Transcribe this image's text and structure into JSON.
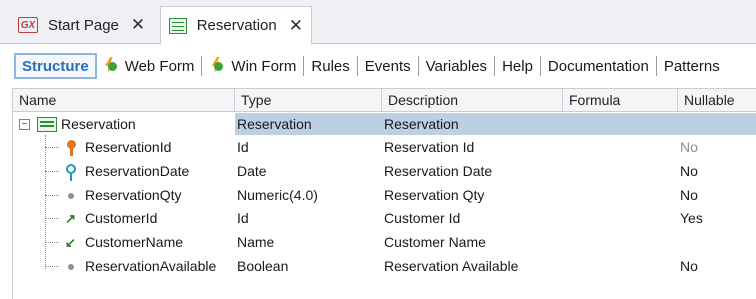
{
  "tabs": [
    {
      "label": "Start Page",
      "icon": "genexus-icon",
      "close": "✕"
    },
    {
      "label": "Reservation",
      "icon": "transaction-icon",
      "close": "✕"
    }
  ],
  "sections": [
    "Structure",
    "Web Form",
    "Win Form",
    "Rules",
    "Events",
    "Variables",
    "Help",
    "Documentation",
    "Patterns"
  ],
  "columns": [
    "Name",
    "Type",
    "Description",
    "Formula",
    "Nullable"
  ],
  "root": {
    "name": "Reservation",
    "type": "Reservation",
    "description": "Reservation",
    "expander": "−"
  },
  "attributes": [
    {
      "name": "ReservationId",
      "type": "Id",
      "description": "Reservation Id",
      "nullable": "No",
      "icon": "primary-key-icon"
    },
    {
      "name": "ReservationDate",
      "type": "Date",
      "description": "Reservation Date",
      "nullable": "No",
      "icon": "index-icon"
    },
    {
      "name": "ReservationQty",
      "type": "Numeric(4.0)",
      "description": "Reservation Qty",
      "nullable": "No",
      "icon": "attribute-dot-icon"
    },
    {
      "name": "CustomerId",
      "type": "Id",
      "description": "Customer Id",
      "nullable": "Yes",
      "icon": "foreign-key-icon"
    },
    {
      "name": "CustomerName",
      "type": "Name",
      "description": "Customer Name",
      "nullable": "",
      "icon": "inferred-attribute-icon"
    },
    {
      "name": "ReservationAvailable",
      "type": "Boolean",
      "description": "Reservation Available",
      "nullable": "No",
      "icon": "attribute-dot-icon"
    }
  ],
  "colors": {
    "selection": "#bccfe3",
    "active_section": "#2a6fb8"
  }
}
